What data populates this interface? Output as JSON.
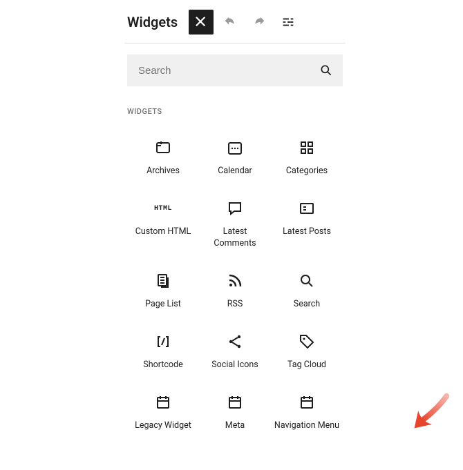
{
  "header": {
    "title": "Widgets"
  },
  "search": {
    "placeholder": "Search",
    "value": ""
  },
  "section_label": "WIDGETS",
  "widgets": [
    {
      "id": "archives",
      "label": "Archives",
      "icon": "archives"
    },
    {
      "id": "calendar",
      "label": "Calendar",
      "icon": "calendar"
    },
    {
      "id": "categories",
      "label": "Categories",
      "icon": "categories"
    },
    {
      "id": "custom-html",
      "label": "Custom HTML",
      "icon": "html-text"
    },
    {
      "id": "latest-comments",
      "label": "Latest Comments",
      "icon": "comment"
    },
    {
      "id": "latest-posts",
      "label": "Latest Posts",
      "icon": "post-list"
    },
    {
      "id": "page-list",
      "label": "Page List",
      "icon": "pages"
    },
    {
      "id": "rss",
      "label": "RSS",
      "icon": "rss"
    },
    {
      "id": "search",
      "label": "Search",
      "icon": "search"
    },
    {
      "id": "shortcode",
      "label": "Shortcode",
      "icon": "shortcode"
    },
    {
      "id": "social-icons",
      "label": "Social Icons",
      "icon": "share"
    },
    {
      "id": "tag-cloud",
      "label": "Tag Cloud",
      "icon": "tag"
    },
    {
      "id": "legacy-widget",
      "label": "Legacy Widget",
      "icon": "legacy"
    },
    {
      "id": "meta",
      "label": "Meta",
      "icon": "legacy"
    },
    {
      "id": "navigation-menu",
      "label": "Navigation Menu",
      "icon": "legacy"
    }
  ],
  "annotation": {
    "arrow_color": "#e8452e",
    "target_widget": "navigation-menu"
  }
}
